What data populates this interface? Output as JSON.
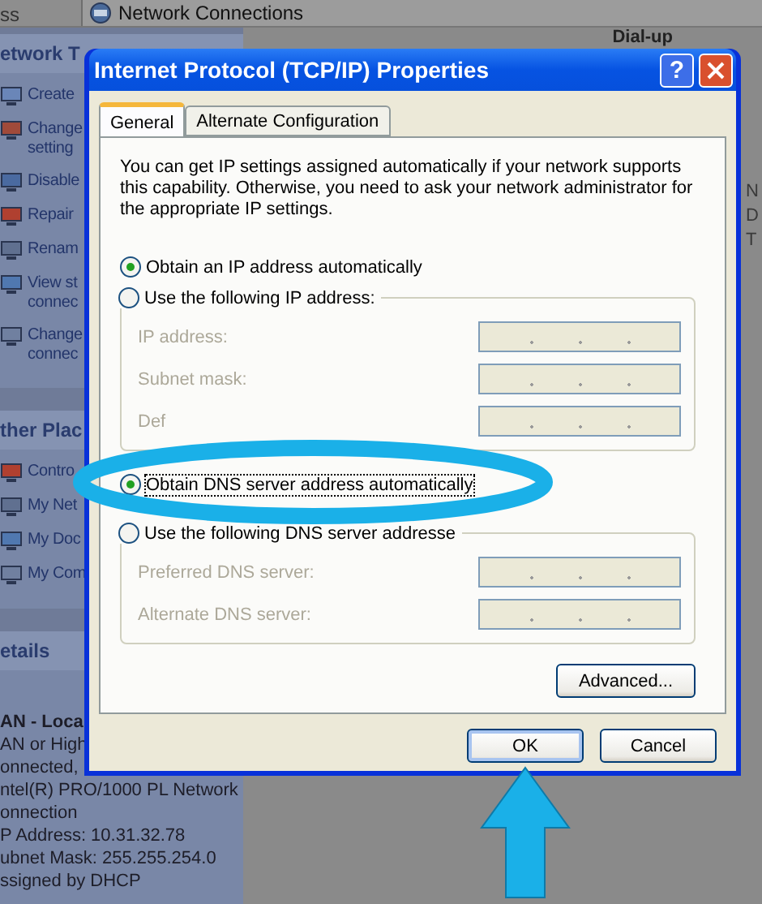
{
  "address_bar": {
    "label": "ss",
    "value": "Network Connections"
  },
  "sidebar": {
    "sections": [
      {
        "title": "etwork T",
        "items": [
          {
            "lines": [
              "Create"
            ]
          },
          {
            "lines": [
              "Change",
              "setting"
            ]
          },
          {
            "lines": [
              "Disable"
            ]
          },
          {
            "lines": [
              "Repair"
            ]
          },
          {
            "lines": [
              "Renam"
            ]
          },
          {
            "lines": [
              "View st",
              "connec"
            ]
          },
          {
            "lines": [
              "Change",
              "connec"
            ]
          }
        ]
      },
      {
        "title": "ther Plac",
        "items": [
          {
            "lines": [
              "Contro"
            ]
          },
          {
            "lines": [
              "My Net"
            ]
          },
          {
            "lines": [
              "My Doc"
            ]
          },
          {
            "lines": [
              "My Com"
            ]
          }
        ]
      },
      {
        "title": "etails",
        "details": [
          "AN - Loca",
          "AN or High",
          "onnected,",
          "ntel(R) PRO/1000 PL Network",
          "onnection",
          "P Address: 10.31.32.78",
          "ubnet Mask: 255.255.254.0",
          "ssigned by DHCP"
        ]
      }
    ]
  },
  "main": {
    "heading": "Dial-up",
    "right_letters": [
      "N",
      "D",
      "T"
    ]
  },
  "dialog": {
    "title": "Internet Protocol (TCP/IP) Properties",
    "help": "?",
    "tabs": [
      {
        "label": "General",
        "selected": true
      },
      {
        "label": "Alternate Configuration",
        "selected": false
      }
    ],
    "description": "You can get IP settings assigned automatically if your network supports this capability. Otherwise, you need to ask your network administrator for the appropriate IP settings.",
    "ip_auto": {
      "label": "Obtain an IP address automatically",
      "selected": true,
      "focused": false
    },
    "ip_group": {
      "radio": {
        "label": "Use the following IP address:",
        "selected": false
      },
      "fields": [
        {
          "label": "IP address:",
          "disabled": true
        },
        {
          "label": "Subnet mask:",
          "disabled": true
        },
        {
          "label": "Def",
          "disabled": true
        }
      ]
    },
    "dns_auto": {
      "label": "Obtain DNS server address automatically",
      "selected": true,
      "focused": true
    },
    "dns_group": {
      "radio": {
        "label": "Use the following DNS server addresse",
        "selected": false
      },
      "fields": [
        {
          "label": "Preferred DNS server:",
          "disabled": true
        },
        {
          "label": "Alternate DNS server:",
          "disabled": true
        }
      ]
    },
    "advanced_button": "Advanced...",
    "buttons": [
      {
        "label": "OK",
        "default": true
      },
      {
        "label": "Cancel",
        "default": false
      }
    ]
  }
}
